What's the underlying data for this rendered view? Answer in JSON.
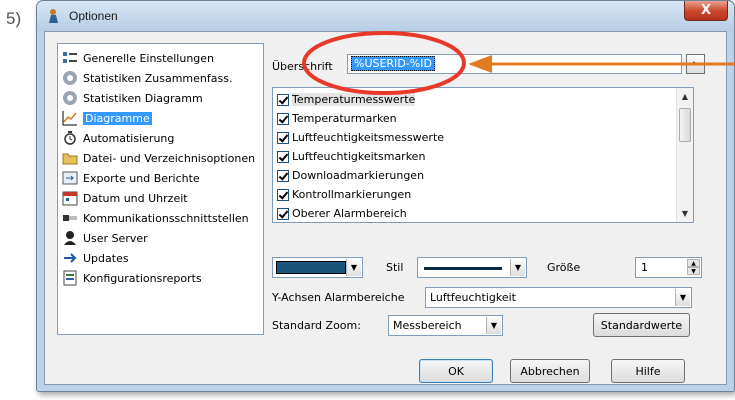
{
  "step": "5)",
  "window": {
    "title": "Optionen",
    "close_label": "X"
  },
  "nav": {
    "items": [
      {
        "label": "Generelle Einstellungen",
        "icon": "settings-icon"
      },
      {
        "label": "Statistiken Zusammenfass.",
        "icon": "stats-summary-icon"
      },
      {
        "label": "Statistiken Diagramm",
        "icon": "stats-chart-icon"
      },
      {
        "label": "Diagramme",
        "icon": "line-chart-icon",
        "selected": true
      },
      {
        "label": "Automatisierung",
        "icon": "automation-icon"
      },
      {
        "label": "Datei- und Verzeichnisoptionen",
        "icon": "folder-icon"
      },
      {
        "label": "Exporte und Berichte",
        "icon": "export-icon"
      },
      {
        "label": "Datum und Uhrzeit",
        "icon": "calendar-icon"
      },
      {
        "label": "Kommunikationsschnittstellen",
        "icon": "connector-icon"
      },
      {
        "label": "User Server",
        "icon": "user-server-icon"
      },
      {
        "label": "Updates",
        "icon": "arrow-right-icon"
      },
      {
        "label": "Konfigurationsreports",
        "icon": "report-icon"
      }
    ]
  },
  "heading": {
    "label": "Überschrift",
    "value": "%USERID-%ID"
  },
  "series_list": {
    "items": [
      "Temperaturmesswerte",
      "Temperaturmarken",
      "Luftfeuchtigkeitsmesswerte",
      "Luftfeuchtigkeitsmarken",
      "Downloadmarkierungen",
      "Kontrollmarkierungen",
      "Oberer Alarmbereich"
    ]
  },
  "style_row": {
    "stil_label": "Stil",
    "groesse_label": "Größe",
    "groesse_value": "1",
    "color": "#1b5479"
  },
  "y_axis": {
    "label": "Y-Achsen Alarmbereiche",
    "value": "Luftfeuchtigkeit"
  },
  "zoom": {
    "label": "Standard Zoom:",
    "value": "Messbereich"
  },
  "buttons": {
    "defaults": "Standardwerte",
    "ok": "OK",
    "cancel": "Abbrechen",
    "help": "Hilfe"
  },
  "colors": {
    "highlight": "#3399ff",
    "annotation": "#e8382a",
    "arrow": "#e07b22"
  }
}
